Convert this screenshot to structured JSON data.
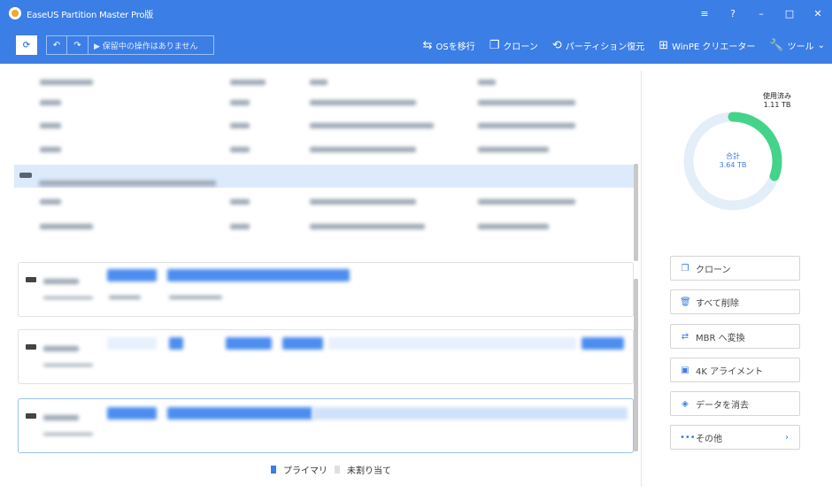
{
  "app": {
    "title": "EaseUS Partition Master Pro版"
  },
  "window_controls": {
    "menu_icon": "≡",
    "help_icon": "?",
    "minimize": "–",
    "maximize": "□",
    "close": "✕"
  },
  "toolbar": {
    "refresh": "⟳",
    "undo": "↶",
    "redo": "↷",
    "pending_text": "▶ 保留中の操作はありません",
    "items": [
      {
        "icon": "⇆",
        "label": "OSを移行"
      },
      {
        "icon": "❐",
        "label": "クローン"
      },
      {
        "icon": "⟲",
        "label": "パーティション復元"
      },
      {
        "icon": "⊞",
        "label": "WinPE クリエーター"
      },
      {
        "icon": "🔧",
        "label": "ツール"
      }
    ],
    "tools_chevron": "⌄"
  },
  "legend": {
    "primary": "プライマリ",
    "unallocated": "未割り当て"
  },
  "usage": {
    "title": "使用済み",
    "value": "1.11 TB",
    "fraction": 0.305
  },
  "total": {
    "label": "合計",
    "value": "3.64 TB"
  },
  "colors": {
    "accent": "#3b7ee6",
    "donut_used": "#43d48a",
    "donut_track": "#e4eef9"
  },
  "actions": [
    {
      "icon": "❐",
      "label": "クローン"
    },
    {
      "icon": "🗑",
      "label": "すべて削除"
    },
    {
      "icon": "⇄",
      "label": "MBR へ変換"
    },
    {
      "icon": "▣",
      "label": "4K アライメント"
    },
    {
      "icon": "◈",
      "label": "データを消去"
    },
    {
      "icon": "•••",
      "label": "その他",
      "chevron": "›"
    }
  ]
}
